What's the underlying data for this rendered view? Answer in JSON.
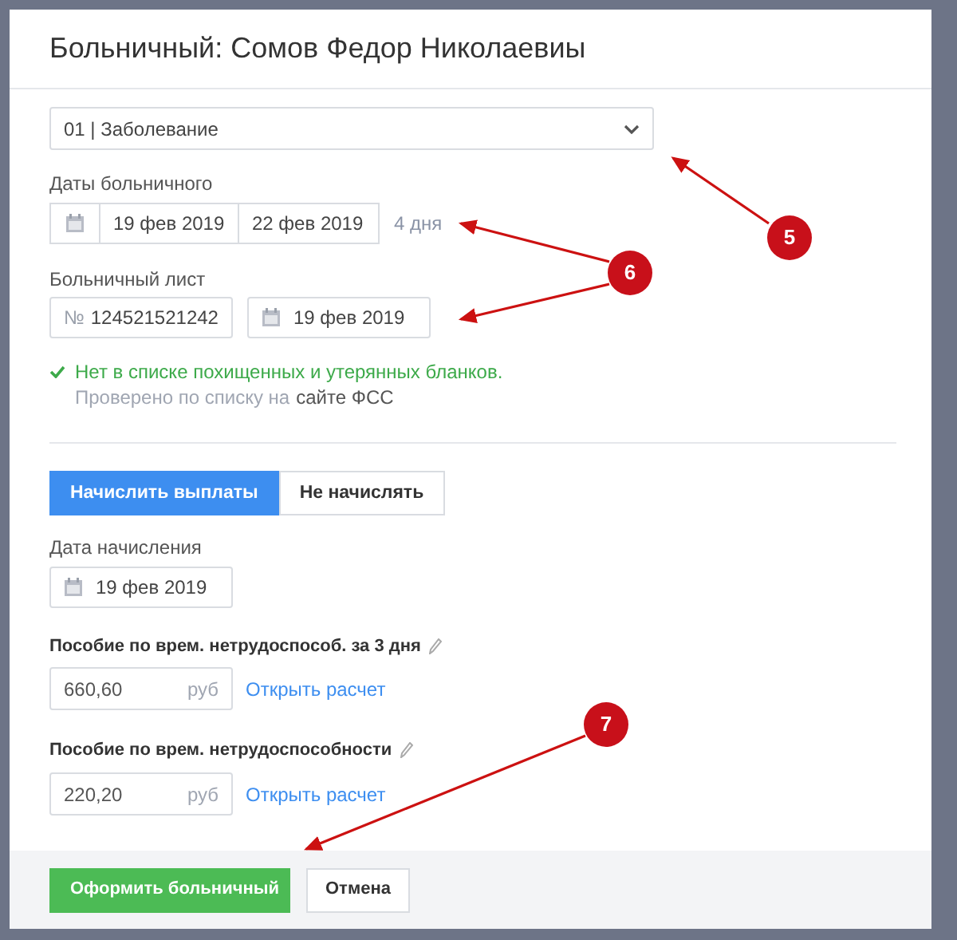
{
  "dialog": {
    "title": "Больничный: Сомов Федор Николаевиы"
  },
  "reason_select": {
    "value": "01 | Заболевание"
  },
  "sick_dates": {
    "label": "Даты больничного",
    "from": "19 фев 2019",
    "to": "22 фев 2019",
    "duration": "4 дня"
  },
  "sick_sheet": {
    "label": "Больничный лист",
    "number_prefix": "№",
    "number": "124521521242",
    "date": "19 фев 2019"
  },
  "check": {
    "message": "Нет в списке похищенных и утерянных бланков.",
    "note": "Проверено по списку на",
    "link": "сайте ФСС"
  },
  "payment_toggle": [
    {
      "label": "Начислить выплаты",
      "selected": true
    },
    {
      "label": "Не начислять",
      "selected": false
    }
  ],
  "accrual_date": {
    "label": "Дата начисления",
    "value": "19 фев 2019"
  },
  "benefits": [
    {
      "label": "Пособие по врем. нетрудоспособ. за 3 дня",
      "value": "660,60",
      "unit": "руб",
      "link": "Открыть расчет"
    },
    {
      "label": "Пособие по врем. нетрудоспособности",
      "value": "220,20",
      "unit": "руб",
      "link": "Открыть расчет"
    }
  ],
  "footer": {
    "buttons": [
      {
        "label": "Оформить больничный",
        "kind": "primary"
      },
      {
        "label": "Отмена",
        "kind": "secondary"
      }
    ]
  },
  "annotations": [
    {
      "label": "5"
    },
    {
      "label": "6"
    },
    {
      "label": "7"
    }
  ]
}
